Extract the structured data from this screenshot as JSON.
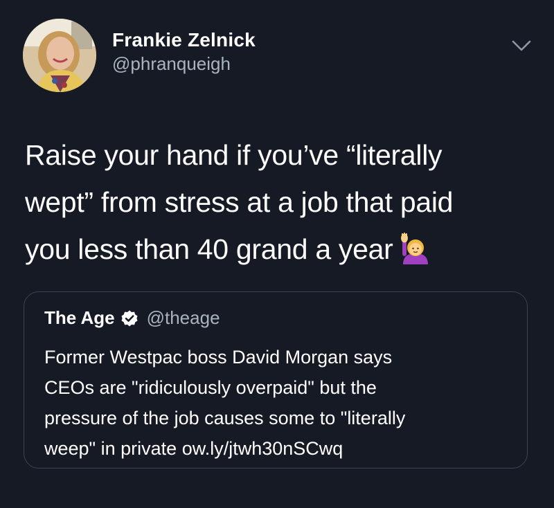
{
  "tweet": {
    "author": {
      "display_name": "Frankie Zelnick",
      "handle": "@phranqueigh"
    },
    "text_lines": [
      "Raise your hand if you’ve “literally",
      "wept” from stress at a job that paid",
      "you less than 40 grand a year"
    ],
    "emoji": "person-raising-hand-emoji",
    "menu_icon": "chevron-down-icon"
  },
  "quoted_tweet": {
    "display_name": "The Age",
    "verified_icon": "verified-badge-icon",
    "handle": "@theage",
    "text_lines": [
      "Former Westpac boss David Morgan says",
      "CEOs are \"ridiculously overpaid\" but the",
      "pressure of the job causes some to \"literally",
      "weep\" in private ow.ly/jtwh30nSCwq"
    ]
  },
  "colors": {
    "background": "#161a25",
    "primary_text": "#ffffff",
    "secondary_text": "#a9b4bf",
    "quote_border": "#3a4452"
  }
}
